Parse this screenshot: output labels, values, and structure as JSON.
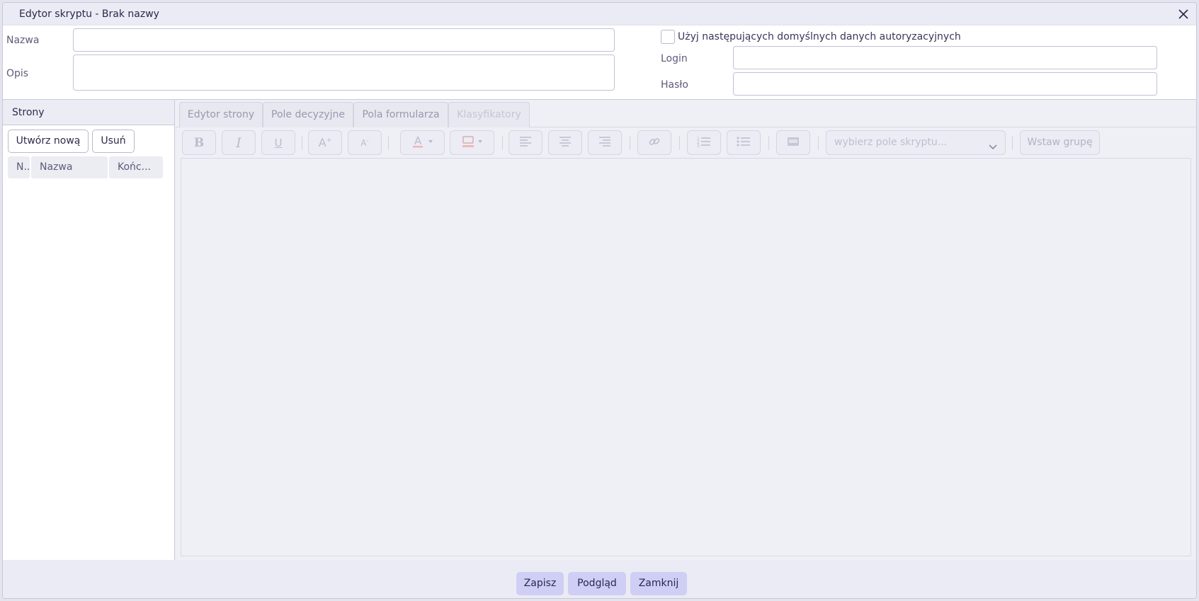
{
  "window": {
    "title": "Edytor skryptu - Brak nazwy",
    "close_icon": "close-icon"
  },
  "form": {
    "name_label": "Nazwa",
    "name_value": "",
    "description_label": "Opis",
    "description_value": "",
    "default_auth_label": "Użyj następujących domyślnych danych autoryzacyjnych",
    "default_auth_checked": false,
    "login_label": "Login",
    "login_value": "",
    "password_label": "Hasło",
    "password_value": ""
  },
  "pages_panel": {
    "header": "Strony",
    "create_button": "Utwórz nową",
    "delete_button": "Usuń",
    "columns": [
      "N...",
      "Nazwa",
      "Końc..."
    ]
  },
  "editor": {
    "tabs": [
      {
        "label": "Edytor strony",
        "disabled": false
      },
      {
        "label": "Pole decyzyjne",
        "disabled": false
      },
      {
        "label": "Pola formularza",
        "disabled": false
      },
      {
        "label": "Klasyfikatory",
        "disabled": true
      }
    ],
    "toolbar": {
      "bold_icon": "bold-icon",
      "italic_icon": "italic-icon",
      "underline_icon": "underline-icon",
      "increase_font_icon": "font-size-increase-icon",
      "decrease_font_icon": "font-size-decrease-icon",
      "font_color_icon": "font-color-icon",
      "highlight_icon": "highlight-color-icon",
      "align_left_icon": "align-left-icon",
      "align_center_icon": "align-center-icon",
      "align_right_icon": "align-right-icon",
      "link_icon": "link-icon",
      "ordered_list_icon": "ordered-list-icon",
      "unordered_list_icon": "unordered-list-icon",
      "image_icon": "image-icon",
      "field_select_placeholder": "wybierz pole skryptu...",
      "insert_group_button": "Wstaw grupę"
    }
  },
  "footer": {
    "save_button": "Zapisz",
    "preview_button": "Podgląd",
    "close_button": "Zamknij"
  },
  "colors": {
    "primary_button": "#cfcff5",
    "background": "#efeff6",
    "text": "#2f2b4a"
  }
}
